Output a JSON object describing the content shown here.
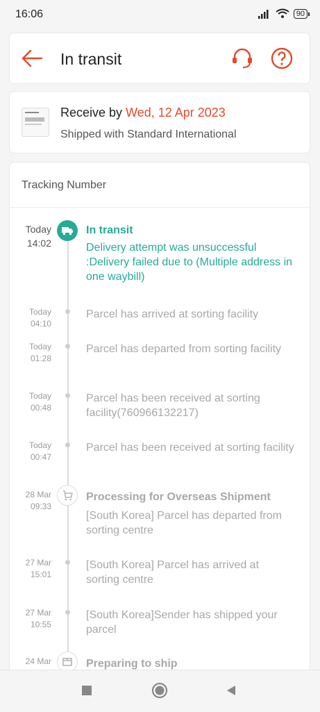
{
  "status_bar": {
    "time": "16:06",
    "battery": "90"
  },
  "header": {
    "title": "In transit"
  },
  "delivery": {
    "receive_prefix": "Receive by ",
    "receive_date": "Wed, 12 Apr 2023",
    "shipped_with": "Shipped with Standard International"
  },
  "tracking": {
    "label": "Tracking Number",
    "events": [
      {
        "date": "Today",
        "time": "14:02",
        "title": "In transit",
        "desc": "Delivery attempt was unsuccessful :Delivery failed due to (Multiple address in one waybill)"
      },
      {
        "date": "Today",
        "time": "04:10",
        "desc": "Parcel has arrived at sorting facility"
      },
      {
        "date": "Today",
        "time": "01:28",
        "desc": "Parcel has departed from sorting facility"
      },
      {
        "date": "Today",
        "time": "00:48",
        "desc": "Parcel has been received at sorting facility(760966132217)"
      },
      {
        "date": "Today",
        "time": "00:47",
        "desc": "Parcel has been received at sorting facility"
      },
      {
        "date": "28 Mar",
        "time": "09:33",
        "title": "Processing for Overseas Shipment",
        "desc": "[South Korea] Parcel has departed from  sorting centre"
      },
      {
        "date": "27 Mar",
        "time": "15:01",
        "desc": "[South Korea] Parcel has arrived at sorting centre"
      },
      {
        "date": "27 Mar",
        "time": "10:55",
        "desc": "[South Korea]Sender has shipped your parcel"
      },
      {
        "date": "24 Mar",
        "time": "",
        "title": "Preparing to ship"
      }
    ]
  }
}
